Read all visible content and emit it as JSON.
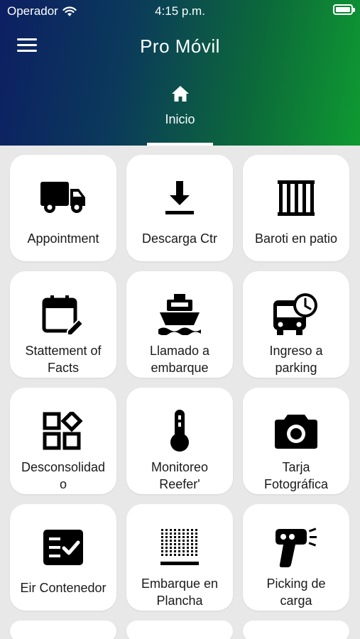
{
  "status_bar": {
    "carrier": "Operador",
    "time": "4:15 p.m."
  },
  "header": {
    "title": "Pro Móvil",
    "tab_label": "Inicio"
  },
  "tiles": [
    {
      "label": "Appointment",
      "icon": "truck-icon"
    },
    {
      "label": "Descarga Ctr",
      "icon": "download-icon"
    },
    {
      "label": "Baroti en patio",
      "icon": "gate-icon"
    },
    {
      "label": "Stattement of\nFacts",
      "icon": "calendar-edit-icon"
    },
    {
      "label": "Llamado a\nembarque",
      "icon": "ship-icon"
    },
    {
      "label": "Ingreso a\nparking",
      "icon": "bus-clock-icon"
    },
    {
      "label": "Desconsolidad\no",
      "icon": "widgets-icon"
    },
    {
      "label": "Monitoreo\nReefer'",
      "icon": "thermometer-icon"
    },
    {
      "label": "Tarja\nFotográfica",
      "icon": "camera-icon"
    },
    {
      "label": "Eir Contenedor",
      "icon": "checklist-icon"
    },
    {
      "label": "Embarque en\nPlancha",
      "icon": "grid-dots-icon"
    },
    {
      "label": "Picking de\ncarga",
      "icon": "barcode-scanner-icon"
    }
  ]
}
